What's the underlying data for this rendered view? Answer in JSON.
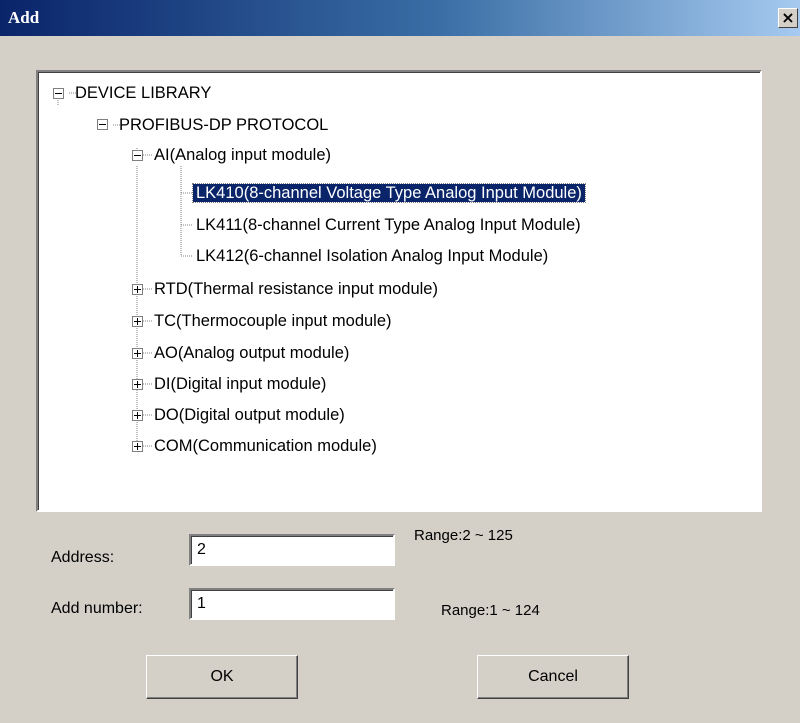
{
  "window": {
    "title": "Add",
    "close_glyph": "×"
  },
  "tree": {
    "root": {
      "label": "DEVICE LIBRARY",
      "expanded": true,
      "children": [
        {
          "label": "PROFIBUS-DP PROTOCOL",
          "expanded": true,
          "children": [
            {
              "label": "AI(Analog input module)",
              "expanded": true,
              "children": [
                {
                  "label": "LK410(8-channel Voltage Type Analog Input Module)",
                  "selected": true
                },
                {
                  "label": "LK411(8-channel Current Type Analog Input Module)"
                },
                {
                  "label": "LK412(6-channel Isolation Analog Input Module)"
                }
              ]
            },
            {
              "label": "RTD(Thermal resistance input module)",
              "expanded": false
            },
            {
              "label": "TC(Thermocouple input module)",
              "expanded": false
            },
            {
              "label": "AO(Analog output module)",
              "expanded": false
            },
            {
              "label": "DI(Digital input module)",
              "expanded": false
            },
            {
              "label": "DO(Digital output module)",
              "expanded": false
            },
            {
              "label": "COM(Communication module)",
              "expanded": false
            }
          ]
        }
      ]
    }
  },
  "form": {
    "address_label": "Address:",
    "address_value": "2",
    "address_range": "Range:2 ~ 125",
    "add_number_label": "Add number:",
    "add_number_value": "1",
    "add_number_range": "Range:1 ~ 124"
  },
  "buttons": {
    "ok_label": "OK",
    "cancel_label": "Cancel"
  },
  "colors": {
    "selection_bg": "#0a246a",
    "dialog_bg": "#d4d0c8",
    "title_gradient_start": "#0a246a",
    "title_gradient_end": "#a6caf0"
  }
}
